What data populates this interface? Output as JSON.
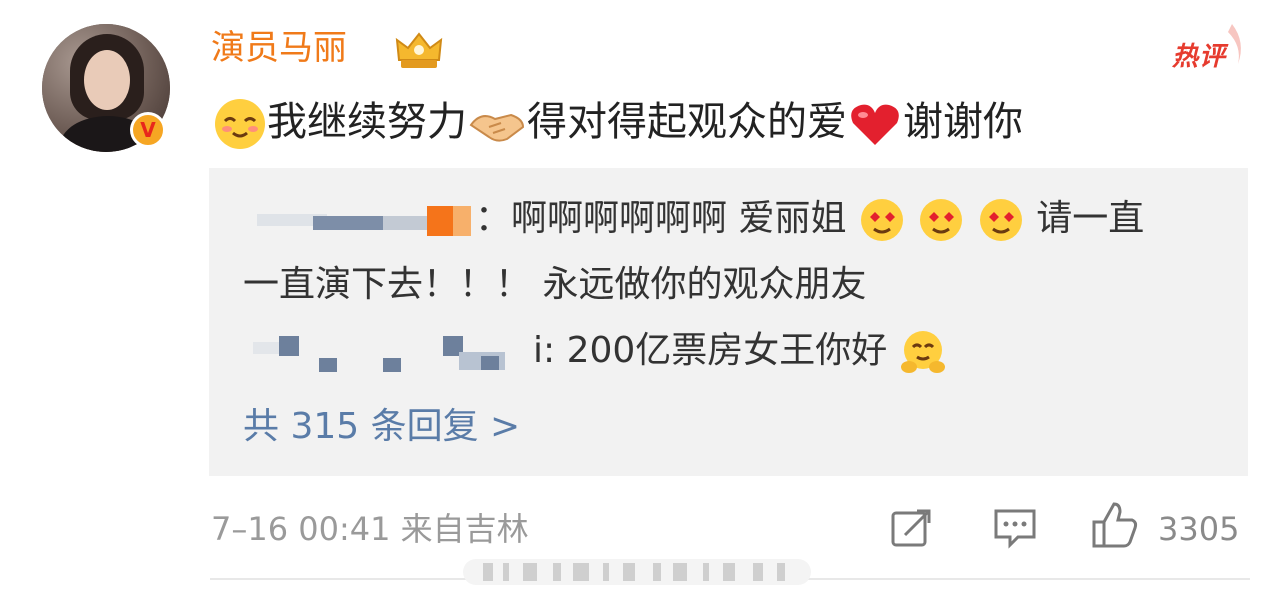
{
  "post": {
    "username": "演员马丽",
    "hot_label": "热评",
    "text_part1": "我继续努力",
    "text_part2": "得对得起观众的爱",
    "text_part3": "谢谢你",
    "emoji_1": "blushing-smile-emoji",
    "emoji_2": "handshake-emoji",
    "emoji_3": "red-heart-emoji"
  },
  "replies": {
    "reply1_line1": "：啊啊啊啊啊啊 爱丽姐",
    "reply1_line1_tail": "请一直",
    "reply1_line2": "一直演下去！！！ 永远做你的观众朋友",
    "reply2_suffix": "i: 200亿票房女王你好",
    "more": "共 315 条回复 >"
  },
  "footer": {
    "meta": "7–16 00:41 来自吉林",
    "like_count": "3305"
  },
  "colors": {
    "username": "#f07a19",
    "link": "#5a7ca8",
    "hot": "#e63b2e",
    "reply_bg": "#f2f2f2"
  }
}
